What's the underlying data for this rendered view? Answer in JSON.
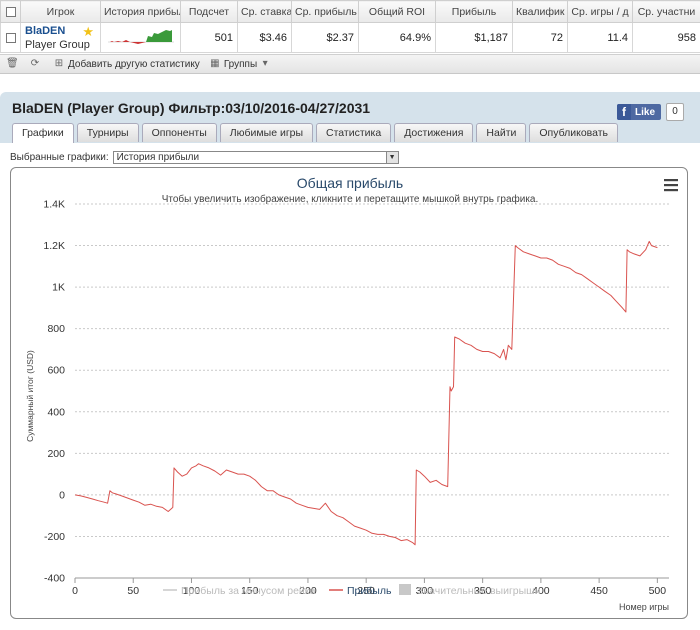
{
  "table": {
    "headers": [
      "",
      "Игрок",
      "История прибыл",
      "Подсчет",
      "Ср. ставка",
      "Ср. прибыль",
      "Общий ROI",
      "Прибыль",
      "Квалифик",
      "Ср. игры / д",
      "Ср. участни"
    ],
    "row": {
      "player_name": "BlaDEN",
      "player_group": "Player Group",
      "count": "501",
      "avg_stake": "$3.46",
      "avg_profit": "$2.37",
      "total_roi": "64.9%",
      "profit": "$1,187",
      "qualified": "72",
      "avg_games_day": "11.4",
      "avg_entrants": "958"
    }
  },
  "toolbar": {
    "add_stats_label": "Добавить другую статистику",
    "groups_label": "Группы"
  },
  "panel": {
    "title": "BlaDEN (Player Group) Фильтр:03/10/2016-04/27/2031",
    "fb_like": "Like",
    "fb_count": "0"
  },
  "tabs": [
    "Графики",
    "Турниры",
    "Оппоненты",
    "Любимые игры",
    "Статистика",
    "Достижения",
    "Найти",
    "Опубликовать"
  ],
  "filter": {
    "label": "Выбранные графики:",
    "selected": "История прибыли"
  },
  "chart_data": {
    "type": "line",
    "title": "Общая прибыль",
    "subtitle": "Чтобы увеличить изображение, кликните и перетащите мышкой внутрь графика.",
    "xlabel": "Номер игры",
    "ylabel": "Суммарный итог (USD)",
    "xlim": [
      0,
      510
    ],
    "ylim": [
      -400,
      1400
    ],
    "xticks": [
      0,
      50,
      100,
      150,
      200,
      250,
      300,
      350,
      400,
      450,
      500
    ],
    "xtick_labels": [
      "0",
      "50",
      "100",
      "150",
      "200",
      "250",
      "300",
      "350",
      "400",
      "450",
      "500"
    ],
    "yticks": [
      -400,
      -200,
      0,
      200,
      400,
      600,
      800,
      1000,
      1200,
      1400
    ],
    "ytick_labels": [
      "-400",
      "-200",
      "0",
      "200",
      "400",
      "600",
      "800",
      "1K",
      "1.2K",
      "1.4K"
    ],
    "grid": true,
    "legend": [
      "Прибыль за минусом рейка",
      "Прибыль",
      "Значительные выигрыши"
    ],
    "legend_colors": [
      "#c8c8c8",
      "#d9534f",
      "#c8c8c8"
    ],
    "series": [
      {
        "name": "Прибыль",
        "color": "#d9534f",
        "x": [
          0,
          5,
          10,
          15,
          20,
          25,
          28,
          30,
          32,
          35,
          40,
          45,
          50,
          55,
          60,
          65,
          70,
          75,
          80,
          84,
          85,
          88,
          92,
          96,
          100,
          104,
          106,
          110,
          115,
          120,
          125,
          130,
          135,
          140,
          145,
          150,
          155,
          160,
          165,
          170,
          175,
          180,
          185,
          190,
          195,
          200,
          205,
          210,
          215,
          220,
          225,
          230,
          235,
          240,
          245,
          250,
          255,
          260,
          265,
          270,
          275,
          280,
          285,
          290,
          292,
          293,
          296,
          300,
          305,
          310,
          315,
          320,
          322,
          323,
          325,
          326,
          330,
          335,
          340,
          345,
          350,
          355,
          360,
          365,
          368,
          370,
          372,
          375,
          378,
          380,
          385,
          390,
          395,
          400,
          405,
          410,
          415,
          420,
          425,
          430,
          435,
          440,
          445,
          450,
          455,
          460,
          465,
          470,
          473,
          474,
          476,
          480,
          485,
          490,
          493,
          495,
          500
        ],
        "y": [
          0,
          -5,
          -12,
          -20,
          -28,
          -35,
          -40,
          20,
          10,
          5,
          -5,
          -15,
          -25,
          -35,
          -50,
          -45,
          -55,
          -60,
          -80,
          -60,
          130,
          110,
          90,
          100,
          130,
          140,
          150,
          140,
          130,
          115,
          95,
          120,
          110,
          100,
          100,
          90,
          70,
          40,
          20,
          20,
          0,
          -10,
          -20,
          -40,
          -50,
          -60,
          -65,
          -70,
          -40,
          -80,
          -100,
          -110,
          -130,
          -150,
          -160,
          -170,
          -185,
          -190,
          -190,
          -200,
          -205,
          -220,
          -215,
          -230,
          -240,
          120,
          110,
          90,
          60,
          70,
          50,
          40,
          520,
          500,
          520,
          760,
          750,
          730,
          720,
          700,
          690,
          690,
          680,
          660,
          700,
          650,
          720,
          700,
          1200,
          1190,
          1170,
          1160,
          1150,
          1140,
          1140,
          1130,
          1110,
          1100,
          1090,
          1070,
          1060,
          1040,
          1020,
          1000,
          980,
          960,
          930,
          900,
          880,
          1180,
          1170,
          1160,
          1150,
          1180,
          1220,
          1200,
          1190
        ]
      }
    ]
  },
  "colors": {
    "panel_bg": "#d5e2eb",
    "player_link": "#1a4f8f",
    "profit_line": "#d9534f",
    "title_color": "#2a4a6b",
    "sparkline_positive": "#3a9a3a",
    "sparkline_negative": "#cc3333"
  }
}
